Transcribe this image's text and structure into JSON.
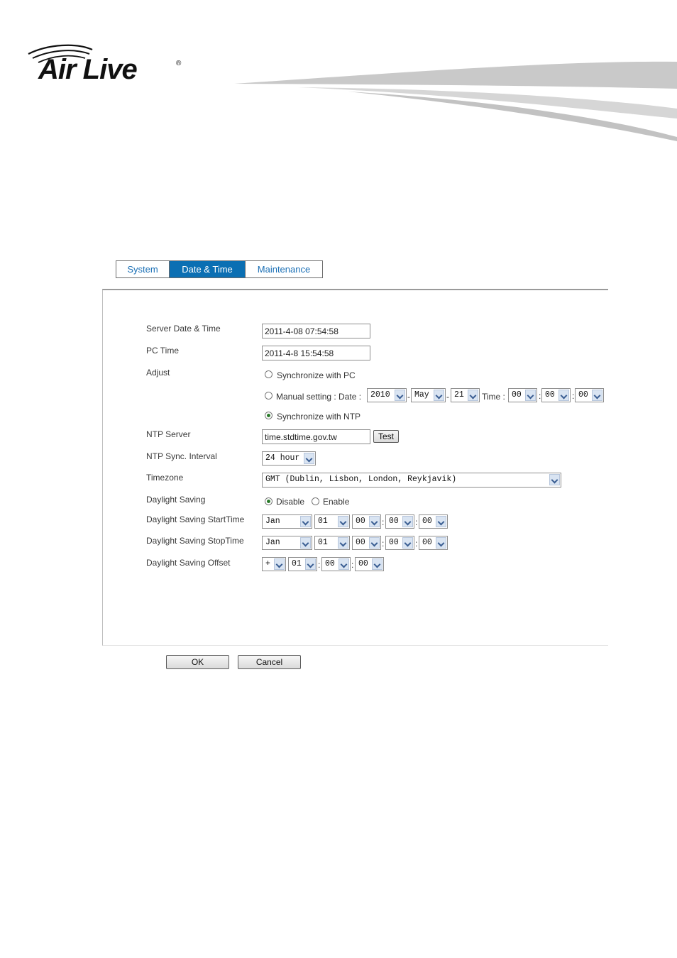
{
  "brand": {
    "logo_text": "Air Live",
    "registered_mark": "®"
  },
  "tabs": [
    {
      "label": "System",
      "active": false
    },
    {
      "label": "Date & Time",
      "active": true
    },
    {
      "label": "Maintenance",
      "active": false
    }
  ],
  "form": {
    "server_datetime": {
      "label": "Server Date & Time",
      "value": "2011-4-08 07:54:58"
    },
    "pc_time": {
      "label": "PC Time",
      "value": "2011-4-8 15:54:58"
    },
    "adjust": {
      "label": "Adjust",
      "sync_pc": "Synchronize with PC",
      "manual": "Manual setting : Date :",
      "year": "2010",
      "month": "May",
      "day": "21",
      "time_label": "Time :",
      "hour": "00",
      "minute": "00",
      "second": "00",
      "sync_ntp": "Synchronize with NTP",
      "selected": "sync_ntp"
    },
    "ntp_server": {
      "label": "NTP Server",
      "value": "time.stdtime.gov.tw",
      "test_button": "Test"
    },
    "ntp_interval": {
      "label": "NTP Sync. Interval",
      "value": "24 hour"
    },
    "timezone": {
      "label": "Timezone",
      "value": "GMT (Dublin, Lisbon, London, Reykjavik)"
    },
    "daylight_saving": {
      "label": "Daylight Saving",
      "disable": "Disable",
      "enable": "Enable",
      "selected": "disable"
    },
    "dst_start": {
      "label": "Daylight Saving StartTime",
      "month": "Jan",
      "day": "01",
      "hour": "00",
      "minute": "00",
      "second": "00"
    },
    "dst_stop": {
      "label": "Daylight Saving StopTime",
      "month": "Jan",
      "day": "01",
      "hour": "00",
      "minute": "00",
      "second": "00"
    },
    "dst_offset": {
      "label": "Daylight Saving Offset",
      "sign": "+",
      "hour": "01",
      "minute": "00",
      "second": "00"
    }
  },
  "buttons": {
    "ok": "OK",
    "cancel": "Cancel"
  },
  "colors": {
    "tab_active_bg": "#0b6fb3",
    "tab_text": "#1a6fb5"
  },
  "separators": {
    "dash": "-",
    "colon": ":"
  }
}
